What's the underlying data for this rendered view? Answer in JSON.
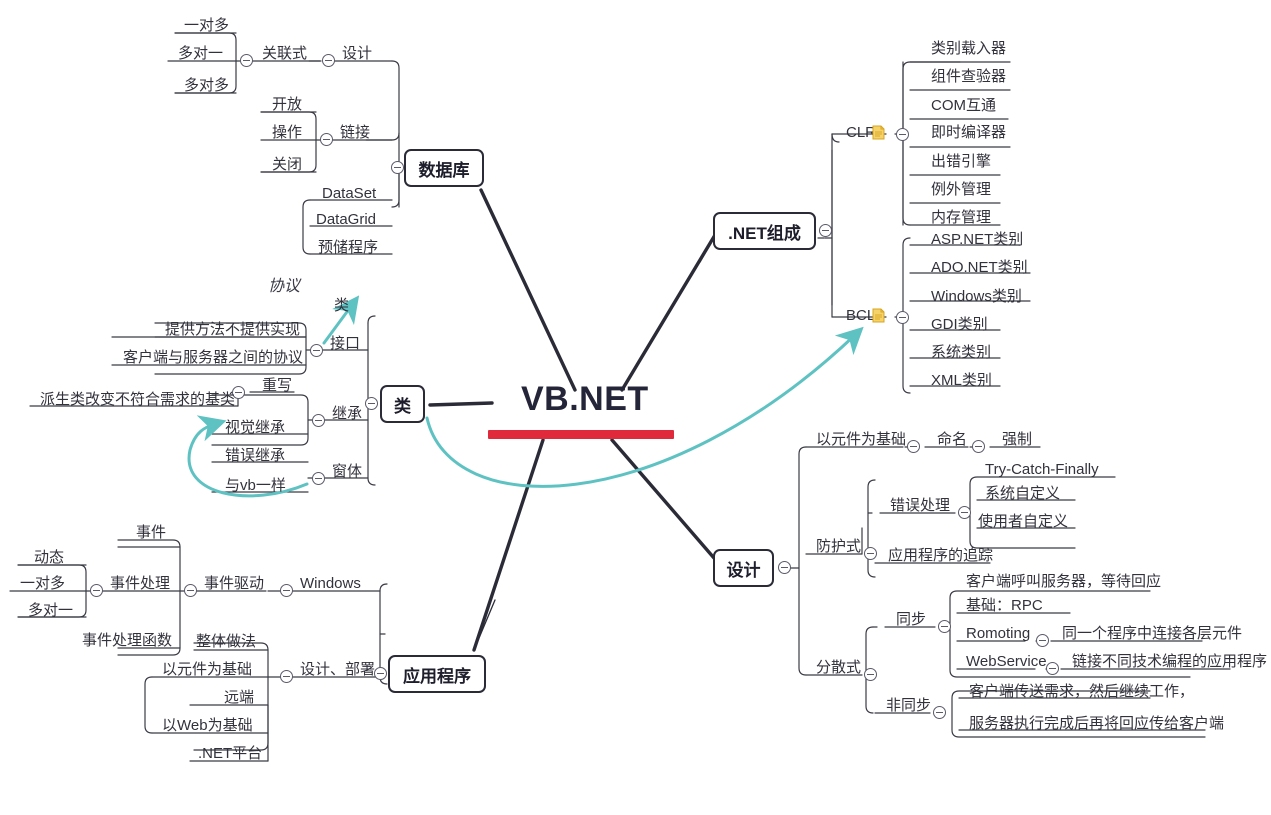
{
  "map": {
    "title": "VB.NET",
    "accent_red": "#e02a3c",
    "accent_teal": "#5fc2c2",
    "line_color": "#3b3b46",
    "note_icon_color": "#f3c43f"
  },
  "central": {
    "label": "VB.NET"
  },
  "branches": {
    "database": {
      "label": "数据库",
      "children": {
        "design": {
          "label": "设计"
        },
        "relational": {
          "label": "关联式"
        },
        "one_to_many": {
          "label": "一对多"
        },
        "many_to_one": {
          "label": "多对一"
        },
        "many_to_many": {
          "label": "多对多"
        },
        "link": {
          "label": "链接"
        },
        "open": {
          "label": "开放"
        },
        "operate": {
          "label": "操作"
        },
        "close": {
          "label": "关闭"
        },
        "dataset": {
          "label": "DataSet"
        },
        "datagrid": {
          "label": "DataGrid"
        },
        "stored_proc": {
          "label": "预储程序"
        }
      }
    },
    "dotnet": {
      "label": ".NET组成",
      "children": {
        "clr": {
          "label": "CLR",
          "icon": "note-icon"
        },
        "class_loader": {
          "label": "类别载入器"
        },
        "assembly_verifier": {
          "label": "组件查验器"
        },
        "com_interop": {
          "label": "COM互通"
        },
        "jit_compiler": {
          "label": "即时编译器"
        },
        "error_engine": {
          "label": "出错引擎"
        },
        "exception_mgmt": {
          "label": "例外管理"
        },
        "memory_mgmt": {
          "label": "内存管理"
        },
        "bcl": {
          "label": "BCL",
          "icon": "note-icon"
        },
        "aspnet_classes": {
          "label": "ASP.NET类别"
        },
        "adonet_classes": {
          "label": "ADO.NET类别"
        },
        "windows_classes": {
          "label": "Windows类别"
        },
        "gdi_classes": {
          "label": "GDI类别"
        },
        "system_classes": {
          "label": "系统类别"
        },
        "xml_classes": {
          "label": "XML类别"
        }
      }
    },
    "clazz": {
      "label": "类",
      "children": {
        "interface": {
          "label": "接口"
        },
        "iface_c1": {
          "label": "提供方法不提供实现"
        },
        "iface_c2": {
          "label": "客户端与服务器之间的协议"
        },
        "inherit": {
          "label": "继承"
        },
        "override": {
          "label": "重写"
        },
        "override_c1": {
          "label": "派生类改变不符合需求的基类"
        },
        "visual_inherit": {
          "label": "视觉继承"
        },
        "error_inherit": {
          "label": "错误继承"
        },
        "form": {
          "label": "窗体"
        },
        "form_c1": {
          "label": "与vb一样"
        }
      }
    },
    "application": {
      "label": "应用程序",
      "children": {
        "windows": {
          "label": "Windows"
        },
        "event_driven": {
          "label": "事件驱动"
        },
        "event_handling": {
          "label": "事件处理"
        },
        "event": {
          "label": "事件"
        },
        "dynamic": {
          "label": "动态"
        },
        "one_to_many": {
          "label": "一对多"
        },
        "many_to_one": {
          "label": "多对一"
        },
        "event_handler_fn": {
          "label": "事件处理函数"
        },
        "design_deploy": {
          "label": "设计、部署"
        },
        "overall": {
          "label": "整体做法"
        },
        "component_based": {
          "label": "以元件为基础"
        },
        "remote": {
          "label": "远端"
        },
        "web_based": {
          "label": "以Web为基础"
        },
        "dotnet_platform": {
          "label": ".NET平台"
        }
      }
    },
    "design": {
      "label": "设计",
      "children": {
        "mandatory": {
          "label": "强制"
        },
        "naming": {
          "label": "命名"
        },
        "component_based": {
          "label": "以元件为基础"
        },
        "defensive": {
          "label": "防护式"
        },
        "error_handling": {
          "label": "错误处理"
        },
        "try_catch_finally": {
          "label": "Try-Catch-Finally"
        },
        "system_defined": {
          "label": "系统自定义"
        },
        "user_defined": {
          "label": "使用者自定义"
        },
        "app_tracing": {
          "label": "应用程序的追踪"
        },
        "distributed": {
          "label": "分散式"
        },
        "sync": {
          "label": "同步"
        },
        "sync_c1": {
          "label": "客户端呼叫服务器，等待回应"
        },
        "sync_c2": {
          "label": "基础：RPC"
        },
        "remoting": {
          "label": "Romoting"
        },
        "remoting_c1": {
          "label": "同一个程序中连接各层元件"
        },
        "webservice": {
          "label": "WebService"
        },
        "webservice_c1": {
          "label": "链接不同技术编程的应用程序"
        },
        "async": {
          "label": "非同步"
        },
        "async_c1": {
          "label": "客户端传送需求，然后继续工作，"
        },
        "async_c2": {
          "label": "服务器执行完成后再将回应传给客户端"
        }
      }
    }
  },
  "annotations": {
    "protocol": {
      "label": "协议"
    },
    "class_target": {
      "label": "类"
    }
  }
}
